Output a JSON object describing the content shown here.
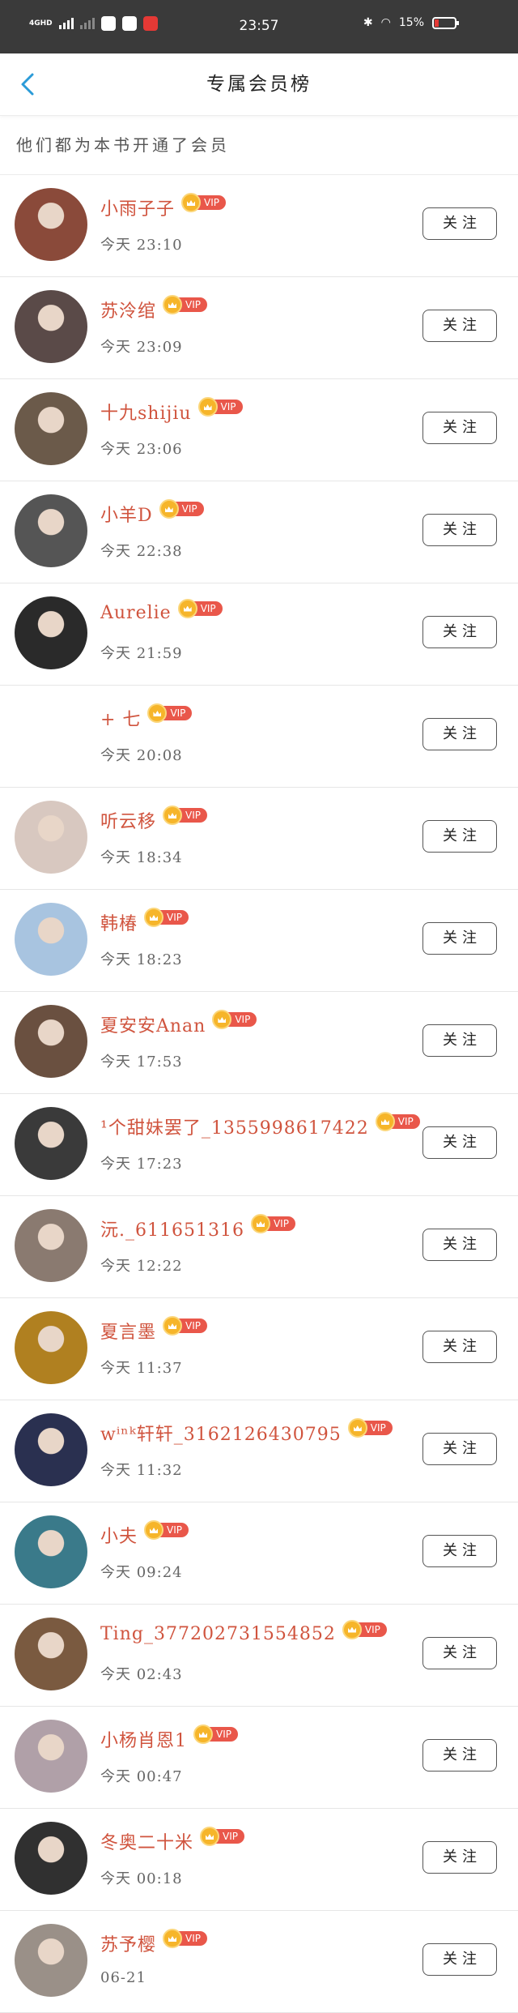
{
  "status_bar": {
    "network": "4GHD",
    "time": "23:57",
    "battery": "15%"
  },
  "header": {
    "title": "专属会员榜"
  },
  "subtitle": "他们都为本书开通了会员",
  "vip_label": "VIP",
  "follow_label": "关注",
  "members": [
    {
      "name": "小雨子子",
      "time": "今天 23:10",
      "avatar_color": "#8a4a3a"
    },
    {
      "name": "苏泠绾",
      "time": "今天 23:09",
      "avatar_color": "#5a4a48"
    },
    {
      "name": "十九shijiu",
      "time": "今天 23:06",
      "avatar_color": "#6b5a4a"
    },
    {
      "name": "小羊D",
      "time": "今天 22:38",
      "avatar_color": "#555555"
    },
    {
      "name": "Aurelie",
      "time": "今天 21:59",
      "avatar_color": "#2a2a2a"
    },
    {
      "name": "+ 七",
      "time": "今天 20:08",
      "avatar_color": "#ffffff"
    },
    {
      "name": "听云移",
      "time": "今天 18:34",
      "avatar_color": "#d8c8c0"
    },
    {
      "name": "韩椿",
      "time": "今天 18:23",
      "avatar_color": "#a8c4e0"
    },
    {
      "name": "夏安安Anan",
      "time": "今天 17:53",
      "avatar_color": "#6a5040"
    },
    {
      "name": "¹个甜妹罢了_1355998617422",
      "time": "今天 17:23",
      "avatar_color": "#3a3a3a"
    },
    {
      "name": "沅._611651316",
      "time": "今天 12:22",
      "avatar_color": "#8a7a70"
    },
    {
      "name": "夏言墨",
      "time": "今天 11:37",
      "avatar_color": "#b08020"
    },
    {
      "name": "wⁱⁿᵏ轩轩_3162126430795",
      "time": "今天 11:32",
      "avatar_color": "#2a3050"
    },
    {
      "name": "小夫",
      "time": "今天 09:24",
      "avatar_color": "#3a7a8a"
    },
    {
      "name": "Ting_377202731554852",
      "time": "今天 02:43",
      "avatar_color": "#7a5a40"
    },
    {
      "name": "小杨肖恩1",
      "time": "今天 00:47",
      "avatar_color": "#b0a0a8"
    },
    {
      "name": "冬奥二十米",
      "time": "今天 00:18",
      "avatar_color": "#303030"
    },
    {
      "name": "苏予樱",
      "time": "06-21",
      "avatar_color": "#9a9088"
    }
  ]
}
